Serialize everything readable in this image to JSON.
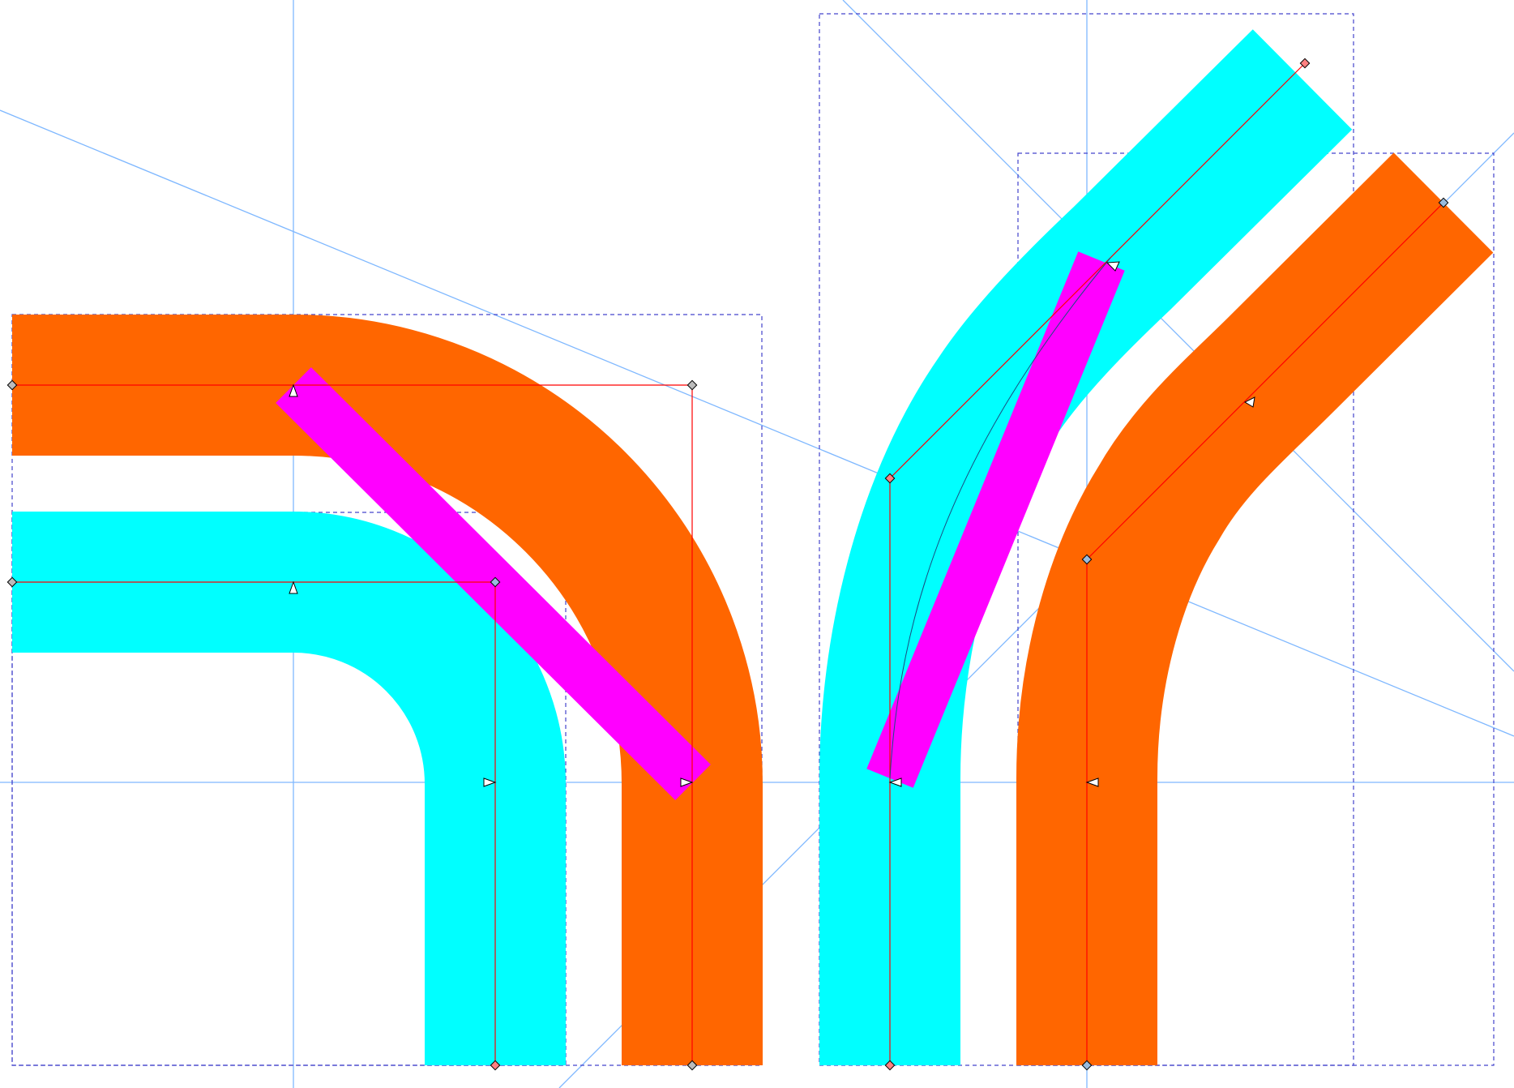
{
  "colors": {
    "orange_track": "#ff6600",
    "cyan_track": "#00ffff",
    "magenta_bar": "#ff00ff",
    "guide_line": "#7fb8ff",
    "path_line": "#ff0000",
    "bbox": "#4444cc",
    "node_white": "#ffffff",
    "node_gray": "#bbbbbb",
    "node_salmon": "#ff8080",
    "node_blue": "#99bbdd"
  }
}
